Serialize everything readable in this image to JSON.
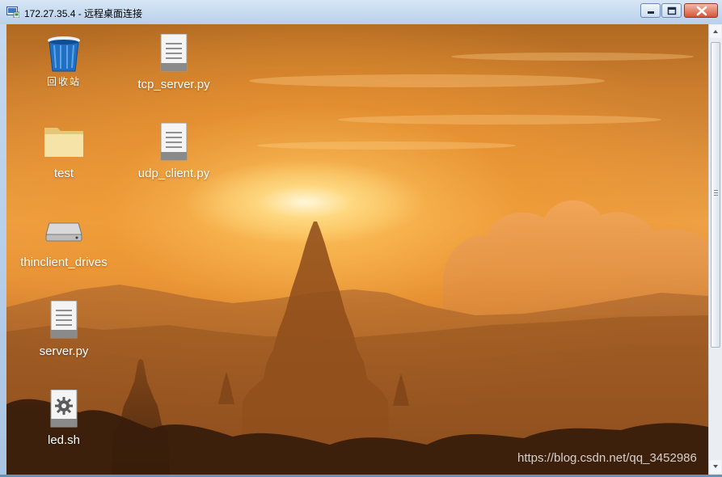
{
  "window": {
    "title": "172.27.35.4 - 远程桌面连接",
    "controls": {
      "minimize": "minimize",
      "maximize": "maximize",
      "close": "close"
    }
  },
  "desktop": {
    "icons": [
      {
        "label": "回收站",
        "icon": "recycle-bin-icon"
      },
      {
        "label": "tcp_server.py",
        "icon": "text-file-icon"
      },
      {
        "label": "test",
        "icon": "folder-icon"
      },
      {
        "label": "udp_client.py",
        "icon": "text-file-icon"
      },
      {
        "label": "thinclient_drives",
        "icon": "drive-icon"
      },
      {
        "label": "server.py",
        "icon": "text-file-icon"
      },
      {
        "label": "led.sh",
        "icon": "script-file-icon"
      }
    ],
    "wallpaper": "sunset-pagoda-wallpaper"
  },
  "watermark": "https://blog.csdn.net/qq_3452986",
  "colors": {
    "titlebar": "#c9dcf1",
    "close_button": "#d4563a",
    "accent_sun": "#ffe9a8"
  }
}
